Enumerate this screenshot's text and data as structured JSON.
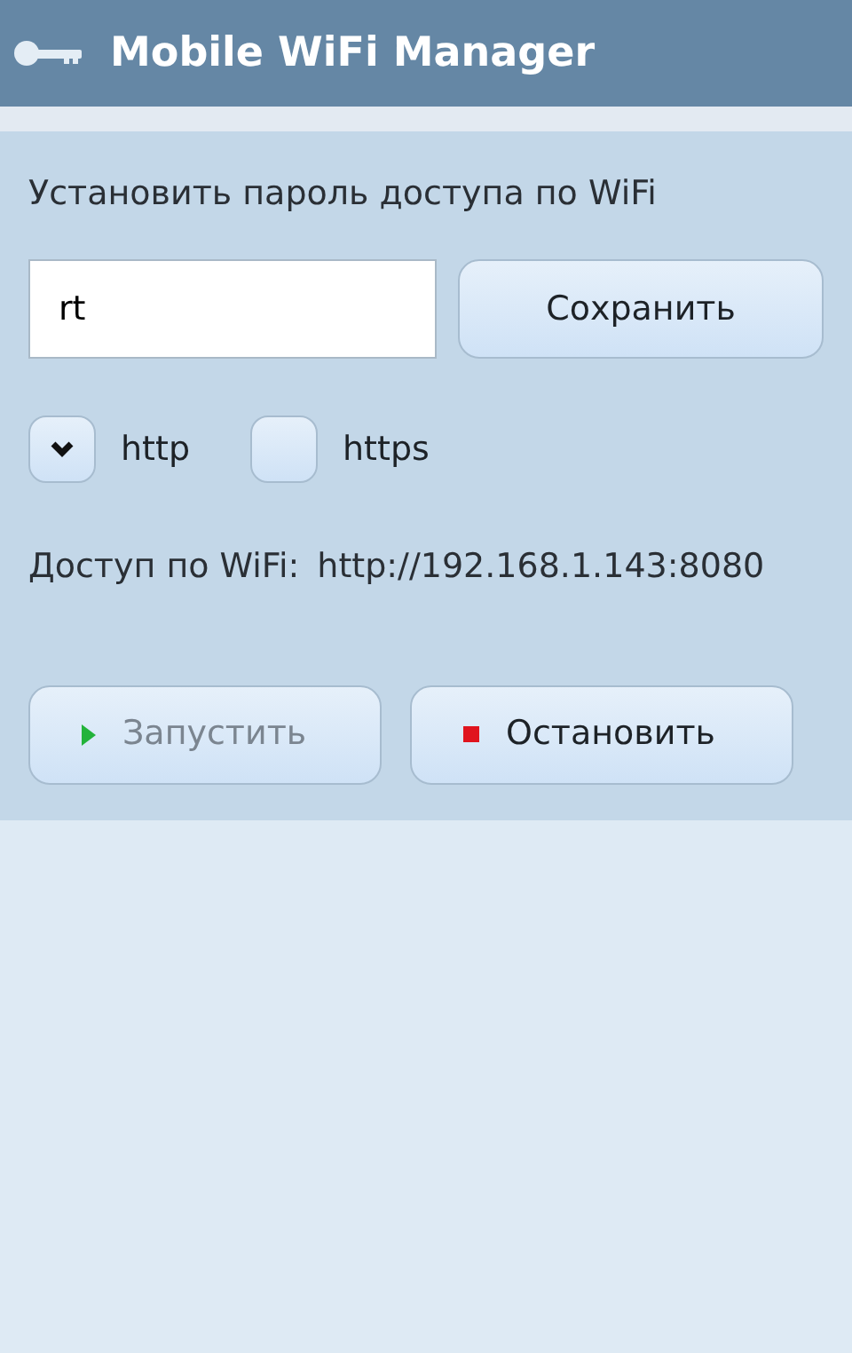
{
  "title_bar": {
    "title": "Mobile WiFi Manager"
  },
  "password": {
    "label": "Установить пароль доступа по WiFi",
    "value": "rt",
    "save_button": "Сохранить"
  },
  "protocols": [
    {
      "label": "http",
      "checked": true
    },
    {
      "label": "https",
      "checked": false
    }
  ],
  "access": {
    "label": "Доступ по WiFi:",
    "url": "http://192.168.1.143:8080"
  },
  "actions": [
    {
      "kind": "start",
      "label": "Запустить",
      "disabled": true
    },
    {
      "kind": "stop",
      "label": "Остановить",
      "disabled": false
    }
  ]
}
